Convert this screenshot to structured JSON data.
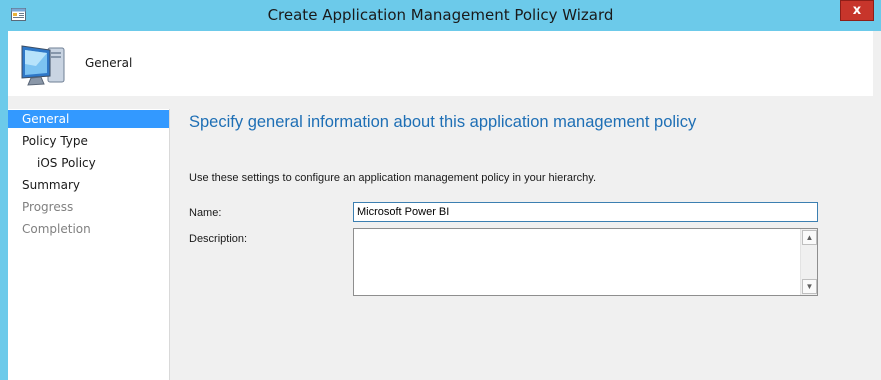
{
  "window": {
    "title": "Create Application Management Policy Wizard",
    "close_label": "x",
    "icons": {
      "title": "app-window-icon",
      "header": "computer-monitor-icon"
    }
  },
  "header": {
    "title": "General"
  },
  "nav": {
    "items": [
      {
        "label": "General",
        "state": "selected"
      },
      {
        "label": "Policy Type",
        "state": "normal"
      },
      {
        "label": "iOS Policy",
        "state": "sub"
      },
      {
        "label": "Summary",
        "state": "normal"
      },
      {
        "label": "Progress",
        "state": "disabled"
      },
      {
        "label": "Completion",
        "state": "disabled"
      }
    ]
  },
  "main": {
    "heading": "Specify general information about this application management policy",
    "description": "Use these settings to configure an application management policy in your hierarchy.",
    "name_label": "Name:",
    "name_value": "Microsoft Power BI",
    "description_label": "Description:",
    "description_value": ""
  },
  "colors": {
    "titlebar": "#6ccaea",
    "close": "#c7352b",
    "selected": "#3399ff",
    "heading": "#1e6fb5"
  }
}
